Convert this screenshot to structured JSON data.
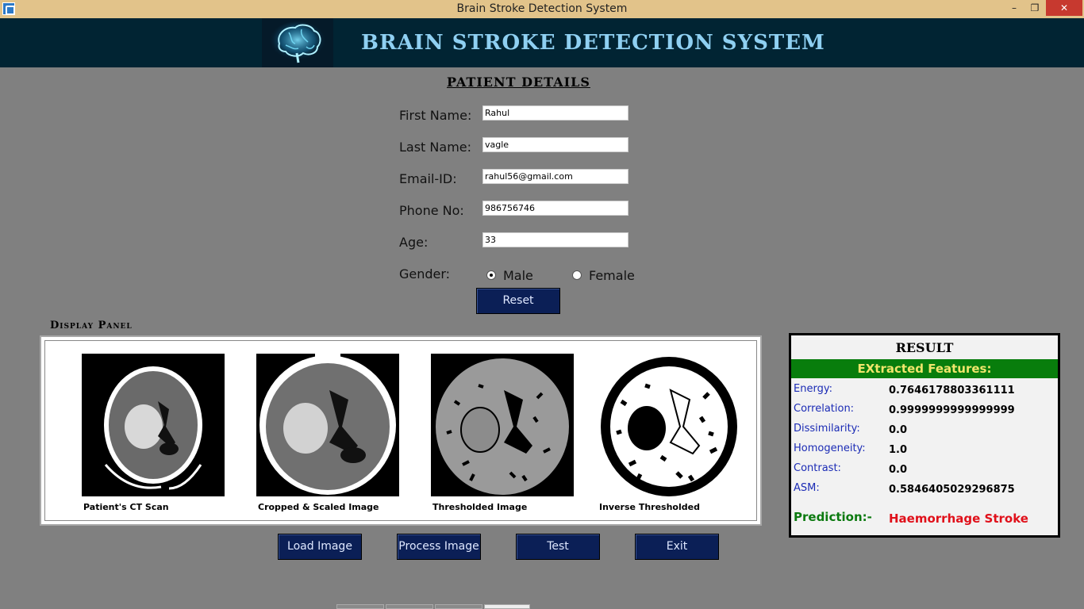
{
  "window": {
    "title": "Brain Stroke Detection System",
    "controls": {
      "minimize": "–",
      "maximize": "❐",
      "close": "✕"
    }
  },
  "banner": {
    "title": "BRAIN STROKE DETECTION SYSTEM"
  },
  "patient": {
    "section_title": "PATIENT DETAILS",
    "first_name_label": "First Name:",
    "first_name_value": "Rahul",
    "last_name_label": "Last Name:",
    "last_name_value": "vagle",
    "email_label": "Email-ID:",
    "email_value": "rahul56@gmail.com",
    "phone_label": "Phone No:",
    "phone_value": "986756746",
    "age_label": "Age:",
    "age_value": "33",
    "gender_label": "Gender:",
    "gender_options": [
      "Male",
      "Female"
    ],
    "gender_selected": "Male",
    "reset_label": "Reset"
  },
  "display_panel": {
    "title": "Display Panel",
    "images": [
      {
        "label": "Patient's CT Scan"
      },
      {
        "label": "Cropped & Scaled Image"
      },
      {
        "label": "Thresholded Image"
      },
      {
        "label": "Inverse Thresholded"
      }
    ]
  },
  "buttons": {
    "load": "Load Image",
    "process": "Process Image",
    "test": "Test",
    "exit": "Exit"
  },
  "result": {
    "title": "RESULT",
    "features_header": "EXtracted Features:",
    "features": [
      {
        "name": "Energy:",
        "value": "0.7646178803361111"
      },
      {
        "name": "Correlation:",
        "value": "0.9999999999999999"
      },
      {
        "name": "Dissimilarity:",
        "value": "0.0"
      },
      {
        "name": "Homogeneity:",
        "value": "1.0"
      },
      {
        "name": "Contrast:",
        "value": "0.0"
      },
      {
        "name": "ASM:",
        "value": "0.5846405029296875"
      }
    ],
    "prediction_label": "Prediction:-",
    "prediction_value": "Haemorrhage Stroke"
  },
  "colors": {
    "banner_bg": "#012433",
    "banner_text": "#8fd0f2",
    "button_bg": "#0b1f56",
    "features_bar": "#087d0c",
    "prediction_label": "#0c7a10",
    "prediction_value": "#e0101a",
    "feature_name": "#1b2bb5"
  }
}
